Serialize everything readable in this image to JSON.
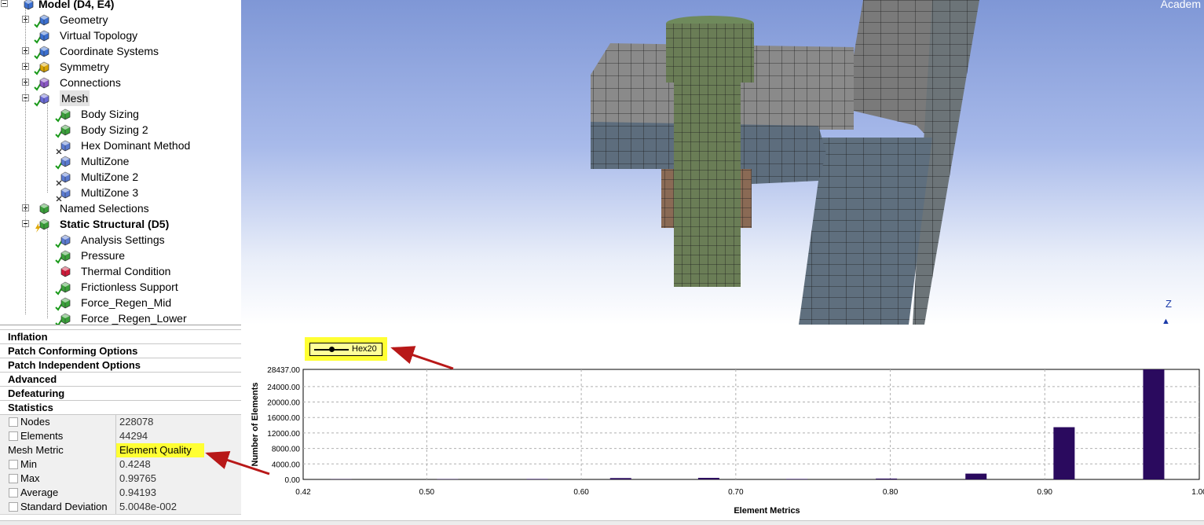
{
  "tree": {
    "items": [
      {
        "label": "Model (D4, E4)",
        "bold": true,
        "expander": "minus",
        "icon": "model-icon",
        "status": "none"
      },
      {
        "label": "Geometry",
        "expander": "plus",
        "icon": "geometry-icon",
        "status": "check"
      },
      {
        "label": "Virtual Topology",
        "expander": "none",
        "icon": "virtual-topology-icon",
        "status": "check"
      },
      {
        "label": "Coordinate Systems",
        "expander": "plus",
        "icon": "coordinate-systems-icon",
        "status": "check"
      },
      {
        "label": "Symmetry",
        "expander": "plus",
        "icon": "symmetry-icon",
        "status": "check"
      },
      {
        "label": "Connections",
        "expander": "plus",
        "icon": "connections-icon",
        "status": "check"
      },
      {
        "label": "Mesh",
        "expander": "minus",
        "icon": "mesh-icon",
        "status": "check",
        "selected": true
      },
      {
        "label": "Body Sizing",
        "expander": "none",
        "icon": "body-sizing-icon",
        "status": "check",
        "indent": 1
      },
      {
        "label": "Body Sizing 2",
        "expander": "none",
        "icon": "body-sizing-icon",
        "status": "check",
        "indent": 1
      },
      {
        "label": "Hex Dominant Method",
        "expander": "none",
        "icon": "method-icon",
        "status": "cross",
        "indent": 1
      },
      {
        "label": "MultiZone",
        "expander": "none",
        "icon": "method-icon",
        "status": "check",
        "indent": 1
      },
      {
        "label": "MultiZone 2",
        "expander": "none",
        "icon": "method-icon",
        "status": "cross",
        "indent": 1
      },
      {
        "label": "MultiZone 3",
        "expander": "none",
        "icon": "method-icon",
        "status": "cross",
        "indent": 1
      },
      {
        "label": "Named Selections",
        "expander": "plus",
        "icon": "named-selections-icon",
        "status": "none"
      },
      {
        "label": "Static Structural (D5)",
        "bold": true,
        "expander": "minus",
        "icon": "static-structural-icon",
        "status": "lightning"
      },
      {
        "label": "Analysis Settings",
        "expander": "none",
        "icon": "analysis-settings-icon",
        "status": "check",
        "indent": 1
      },
      {
        "label": "Pressure",
        "expander": "none",
        "icon": "pressure-icon",
        "status": "check",
        "indent": 1
      },
      {
        "label": "Thermal Condition",
        "expander": "none",
        "icon": "thermal-condition-icon",
        "status": "none",
        "indent": 1
      },
      {
        "label": "Frictionless Support",
        "expander": "none",
        "icon": "frictionless-support-icon",
        "status": "check",
        "indent": 1
      },
      {
        "label": "Force_Regen_Mid",
        "expander": "none",
        "icon": "force-icon",
        "status": "check",
        "indent": 1
      },
      {
        "label": "Force _Regen_Lower",
        "expander": "none",
        "icon": "force-icon",
        "status": "check",
        "indent": 1
      }
    ]
  },
  "details": {
    "categories": [
      "Inflation",
      "Patch Conforming Options",
      "Patch Independent Options",
      "Advanced",
      "Defeaturing",
      "Statistics"
    ],
    "statistics": [
      {
        "name": "Nodes",
        "value": "228078",
        "checkbox": true
      },
      {
        "name": "Elements",
        "value": "44294",
        "checkbox": true
      },
      {
        "name": "Mesh Metric",
        "value": "Element Quality",
        "checkbox": false,
        "highlight": true
      },
      {
        "name": "Min",
        "value": "0.4248",
        "checkbox": true
      },
      {
        "name": "Max",
        "value": "0.99765",
        "checkbox": true
      },
      {
        "name": "Average",
        "value": "0.94193",
        "checkbox": true
      },
      {
        "name": "Standard Deviation",
        "value": "5.0048e-002",
        "checkbox": true
      }
    ]
  },
  "viewport": {
    "watermark": "Academ",
    "axis_label": "Z"
  },
  "legend": {
    "label": "Hex20"
  },
  "colors": {
    "bar": "#2a0a5e",
    "highlight": "#ffff33",
    "arrow": "#b81818"
  },
  "chart_data": {
    "type": "bar",
    "legend": [
      "Hex20"
    ],
    "xlabel": "Element Metrics",
    "ylabel": "Number of Elements",
    "xlim": [
      0.42,
      1.0
    ],
    "ylim": [
      0,
      28437
    ],
    "xticks": [
      "0.42",
      "0.50",
      "0.60",
      "0.70",
      "0.80",
      "0.90",
      "1.00"
    ],
    "yticks": [
      "0.00",
      "4000.00",
      "8000.00",
      "12000.00",
      "16000.00",
      "20000.00",
      "24000.00",
      "28437.00"
    ],
    "grid": true,
    "x": [
      0.4445,
      0.5135,
      0.5715,
      0.6255,
      0.6825,
      0.7395,
      0.7975,
      0.8555,
      0.9125,
      0.9705
    ],
    "values": [
      60,
      80,
      120,
      350,
      400,
      120,
      220,
      1500,
      13500,
      28437
    ]
  }
}
